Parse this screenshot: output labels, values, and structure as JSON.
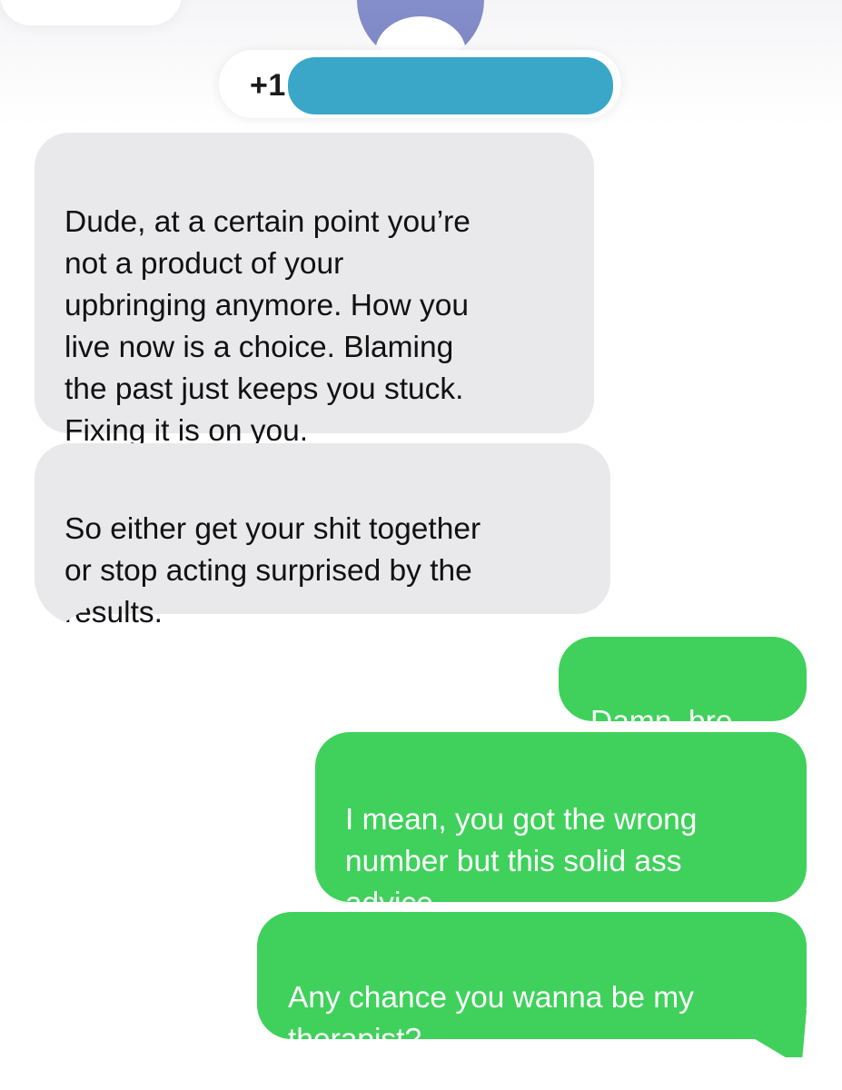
{
  "header": {
    "contact_prefix": "+1",
    "contact_redacted": true,
    "colors": {
      "redaction": "#3aa6c8",
      "avatar": "#8e97cf"
    },
    "avatar_icon": "person-silhouette-icon"
  },
  "thread": {
    "messages": [
      {
        "direction": "incoming",
        "text": "Dude, at a certain point you’re\nnot a product of your\nupbringing anymore. How you\nlive now is a choice. Blaming\nthe past just keeps you stuck.\nFixing it is on you."
      },
      {
        "direction": "incoming",
        "text": "So either get your shit together\nor stop acting surprised by the\nresults."
      },
      {
        "direction": "outgoing",
        "text": "Damn, bro."
      },
      {
        "direction": "outgoing",
        "text": "I mean, you got the wrong\nnumber but this solid ass\nadvice."
      },
      {
        "direction": "outgoing",
        "text": "Any chance you wanna be my\ntherapist?"
      }
    ],
    "colors": {
      "incoming_bubble": "#e9e9eb",
      "outgoing_bubble": "#3fd15b",
      "incoming_text": "#111111",
      "outgoing_text": "#ffffff"
    }
  }
}
